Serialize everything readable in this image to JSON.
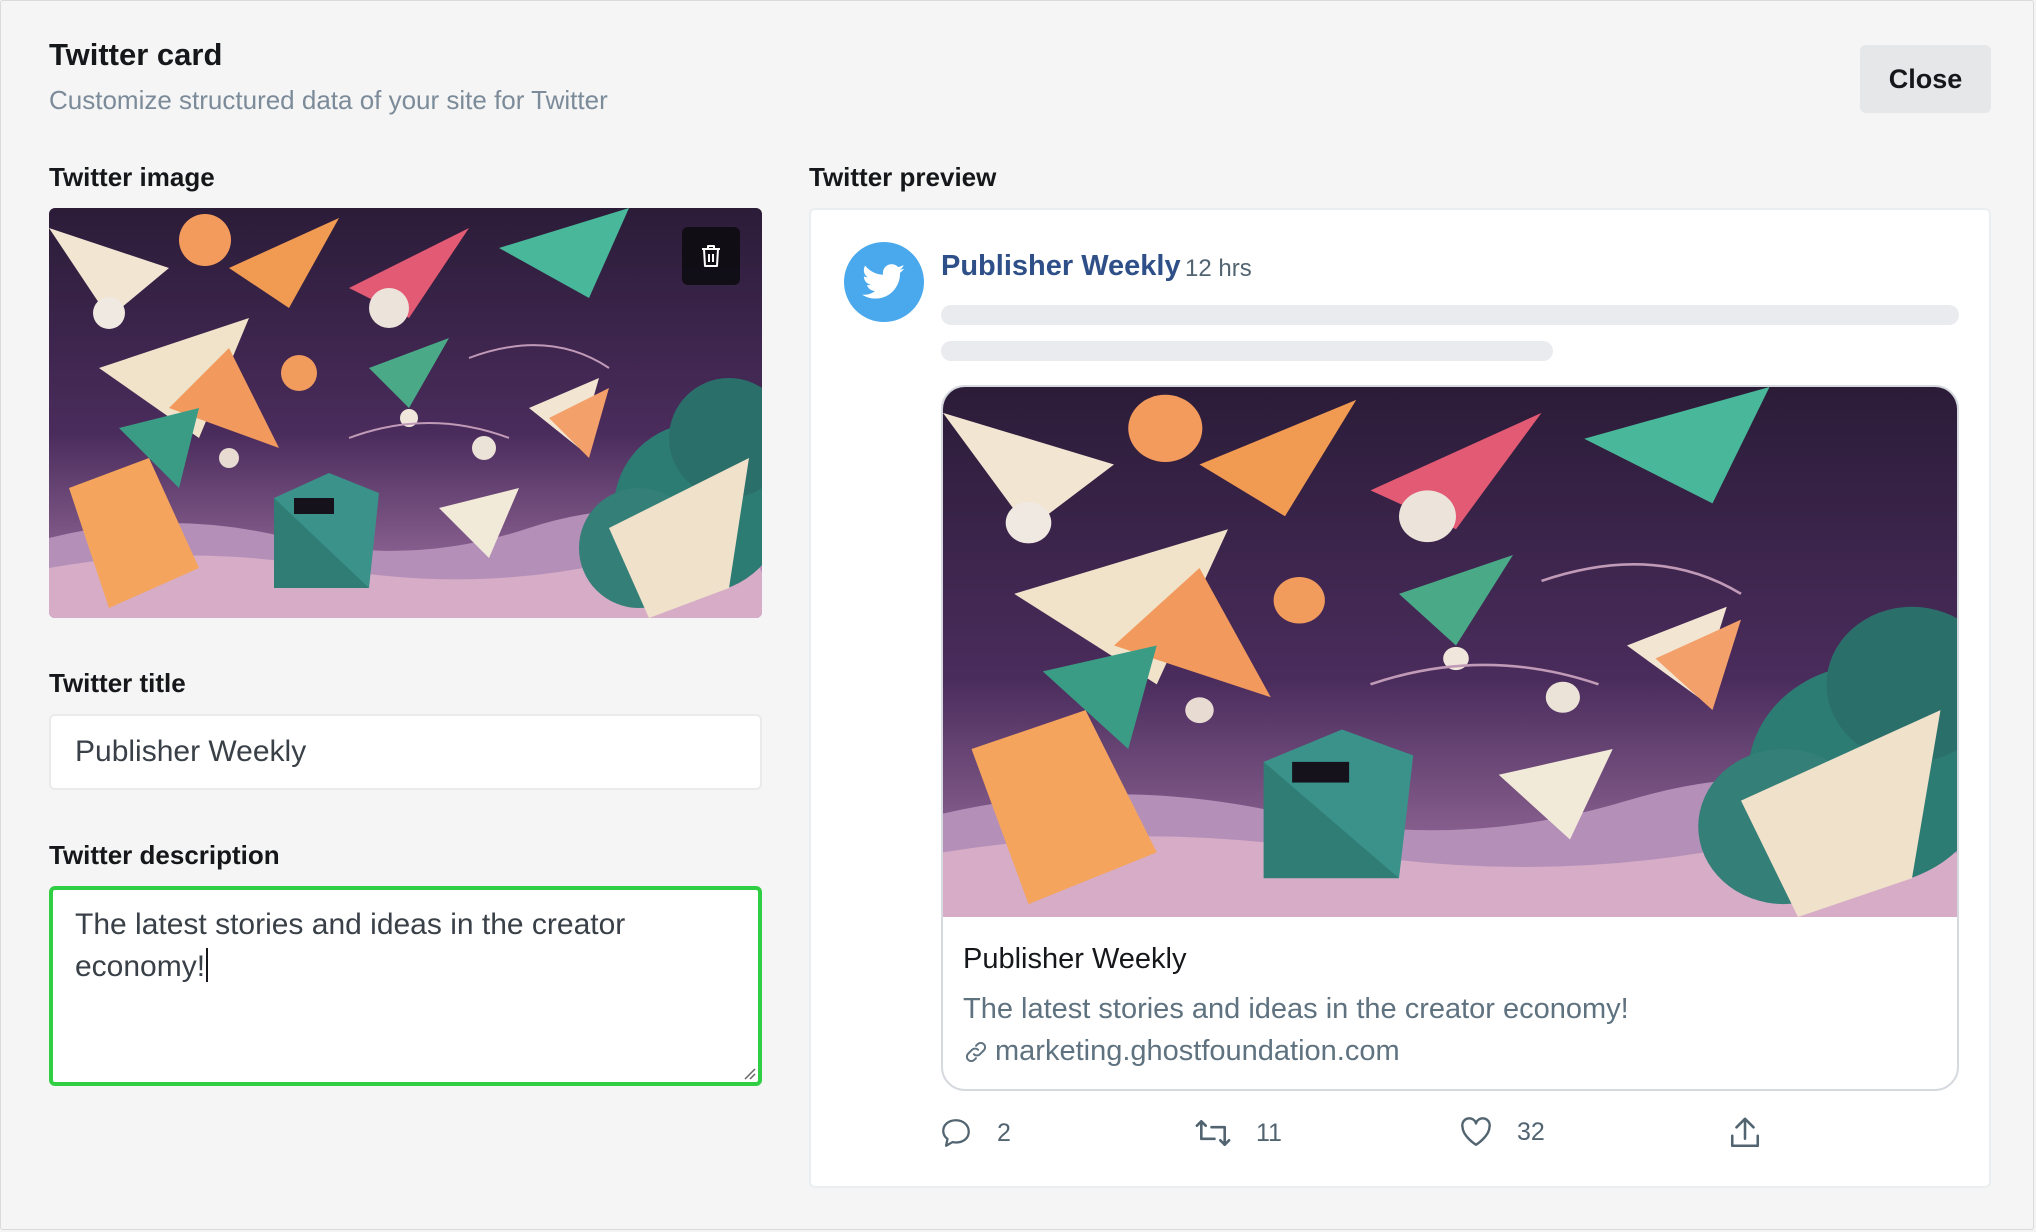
{
  "header": {
    "title": "Twitter card",
    "subtitle": "Customize structured data of your site for Twitter",
    "close_label": "Close"
  },
  "form": {
    "image_label": "Twitter image",
    "title_label": "Twitter title",
    "title_value": "Publisher Weekly",
    "description_label": "Twitter description",
    "description_value": "The latest stories and ideas in the creator economy!"
  },
  "preview": {
    "label": "Twitter preview",
    "account_name": "Publisher Weekly",
    "time": "12 hrs",
    "card_title": "Publisher Weekly",
    "card_description": "The latest stories and ideas in the creator economy!",
    "card_url": "marketing.ghostfoundation.com",
    "replies": "2",
    "retweets": "11",
    "likes": "32"
  },
  "colors": {
    "twitter_blue": "#4aa8ec",
    "focus_green": "#30cf43",
    "name_blue": "#2e4f87"
  },
  "icons": [
    "trash-icon",
    "twitter-bird-icon",
    "link-icon",
    "reply-icon",
    "retweet-icon",
    "like-icon",
    "share-icon"
  ]
}
